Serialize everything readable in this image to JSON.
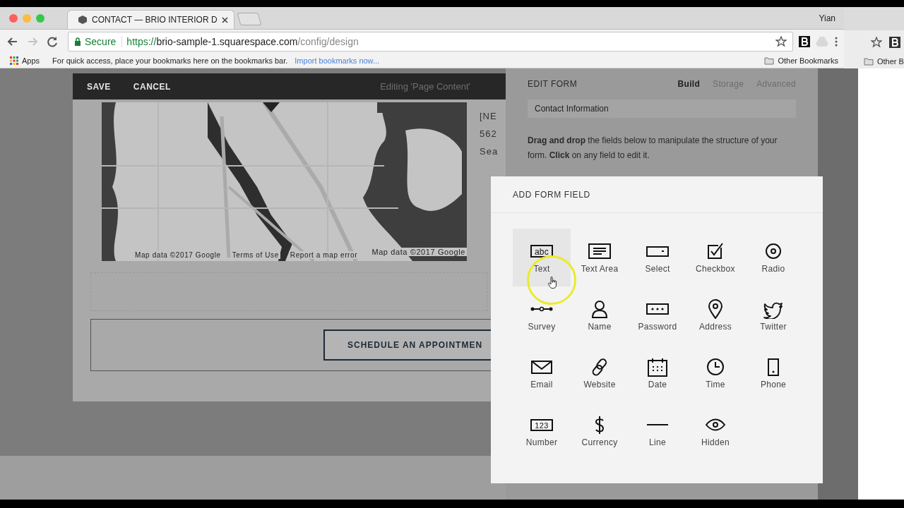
{
  "browser": {
    "tab": {
      "title": "CONTACT — BRIO INTERIOR D",
      "selected": true
    },
    "profile": "Yian",
    "address_bar": {
      "security": "Secure",
      "url_scheme": "https://",
      "url_host": "brio-sample-1.squarespace.com",
      "url_path": "/config/design"
    },
    "bookmarks_bar": {
      "apps": "Apps",
      "hint": "For quick access, place your bookmarks here on the bookmarks bar.",
      "import_link": "Import bookmarks now...",
      "other": "Other Bookmarks"
    }
  },
  "background_window": {
    "bookmarks_label": "Other B"
  },
  "editor_bar": {
    "save": "SAVE",
    "cancel": "CANCEL",
    "status": "Editing 'Page Content'"
  },
  "map": {
    "kind": "picture",
    "attributions": [
      "Map data ©2017 Google",
      "Terms of Use",
      "Report a map error",
      "Map data ©2017 Google"
    ]
  },
  "side_text": [
    "[NE",
    "562",
    "Sea"
  ],
  "schedule_button": "SCHEDULE AN APPOINTMEN",
  "edit_form": {
    "title": "EDIT FORM",
    "tabs": [
      {
        "label": "Build",
        "selected": true
      },
      {
        "label": "Storage",
        "selected": false
      },
      {
        "label": "Advanced",
        "selected": false
      }
    ],
    "field_value": "Contact Information",
    "instructions": "**Drag and drop** the fields below to manipulate the structure of your form. **Click** on any field to edit it."
  },
  "add_form_field": {
    "title": "ADD FORM FIELD",
    "fields": [
      {
        "kind": "text",
        "label": "Text",
        "badge": "abc",
        "highlighted": true
      },
      {
        "kind": "textarea",
        "label": "Text Area",
        "highlighted": false
      },
      {
        "kind": "select",
        "label": "Select",
        "highlighted": false
      },
      {
        "kind": "checkbox",
        "label": "Checkbox",
        "highlighted": false
      },
      {
        "kind": "radio",
        "label": "Radio",
        "highlighted": false
      },
      {
        "kind": "survey",
        "label": "Survey",
        "highlighted": false
      },
      {
        "kind": "name",
        "label": "Name",
        "highlighted": false
      },
      {
        "kind": "password",
        "label": "Password",
        "highlighted": false
      },
      {
        "kind": "address",
        "label": "Address",
        "highlighted": false
      },
      {
        "kind": "twitter",
        "label": "Twitter",
        "highlighted": false
      },
      {
        "kind": "email",
        "label": "Email",
        "highlighted": false
      },
      {
        "kind": "website",
        "label": "Website",
        "highlighted": false
      },
      {
        "kind": "date",
        "label": "Date",
        "highlighted": false
      },
      {
        "kind": "time",
        "label": "Time",
        "highlighted": false
      },
      {
        "kind": "phone",
        "label": "Phone",
        "highlighted": false
      },
      {
        "kind": "number",
        "label": "Number",
        "badge": "123",
        "highlighted": false
      },
      {
        "kind": "currency",
        "label": "Currency",
        "highlighted": false
      },
      {
        "kind": "line",
        "label": "Line",
        "highlighted": false
      },
      {
        "kind": "hidden",
        "label": "Hidden",
        "highlighted": false
      }
    ]
  }
}
